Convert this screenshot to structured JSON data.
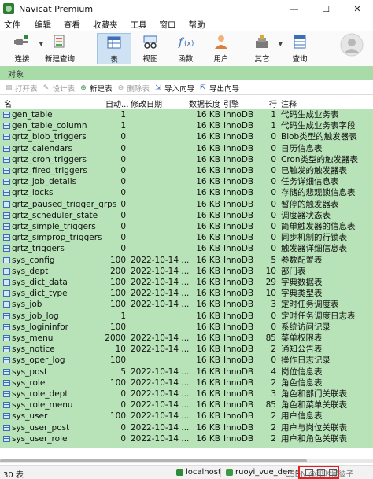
{
  "window": {
    "title": "Navicat Premium",
    "minimize": "—",
    "maximize": "☐",
    "close": "✕"
  },
  "menu": [
    "文件",
    "编辑",
    "查看",
    "收藏夹",
    "工具",
    "窗口",
    "帮助"
  ],
  "toolbar": {
    "connect": "连接",
    "new_query": "新建查询",
    "table": "表",
    "view": "视图",
    "function": "函数",
    "user": "用户",
    "other": "其它",
    "query": "查询"
  },
  "tabs": {
    "objects": "对象"
  },
  "object_toolbar": {
    "open": "打开表",
    "design": "设计表",
    "new": "新建表",
    "delete": "删除表",
    "import": "导入向导",
    "export": "导出向导"
  },
  "columns": {
    "name": "名",
    "auto_inc": "自动...",
    "modified": "修改日期",
    "data_length": "数据长度",
    "engine": "引擎",
    "rows": "行",
    "comment": "注释"
  },
  "rows": [
    {
      "name": "gen_table",
      "auto": "1",
      "mod": "",
      "len": "16 KB",
      "eng": "InnoDB",
      "rows": "1",
      "cmt": "代码生成业务表"
    },
    {
      "name": "gen_table_column",
      "auto": "1",
      "mod": "",
      "len": "16 KB",
      "eng": "InnoDB",
      "rows": "1",
      "cmt": "代码生成业务表字段"
    },
    {
      "name": "qrtz_blob_triggers",
      "auto": "0",
      "mod": "",
      "len": "16 KB",
      "eng": "InnoDB",
      "rows": "0",
      "cmt": "Blob类型的触发器表"
    },
    {
      "name": "qrtz_calendars",
      "auto": "0",
      "mod": "",
      "len": "16 KB",
      "eng": "InnoDB",
      "rows": "0",
      "cmt": "日历信息表"
    },
    {
      "name": "qrtz_cron_triggers",
      "auto": "0",
      "mod": "",
      "len": "16 KB",
      "eng": "InnoDB",
      "rows": "0",
      "cmt": "Cron类型的触发器表"
    },
    {
      "name": "qrtz_fired_triggers",
      "auto": "0",
      "mod": "",
      "len": "16 KB",
      "eng": "InnoDB",
      "rows": "0",
      "cmt": "已触发的触发器表"
    },
    {
      "name": "qrtz_job_details",
      "auto": "0",
      "mod": "",
      "len": "16 KB",
      "eng": "InnoDB",
      "rows": "0",
      "cmt": "任务详细信息表"
    },
    {
      "name": "qrtz_locks",
      "auto": "0",
      "mod": "",
      "len": "16 KB",
      "eng": "InnoDB",
      "rows": "0",
      "cmt": "存储的悲观锁信息表"
    },
    {
      "name": "qrtz_paused_trigger_grps",
      "auto": "0",
      "mod": "",
      "len": "16 KB",
      "eng": "InnoDB",
      "rows": "0",
      "cmt": "暂停的触发器表"
    },
    {
      "name": "qrtz_scheduler_state",
      "auto": "0",
      "mod": "",
      "len": "16 KB",
      "eng": "InnoDB",
      "rows": "0",
      "cmt": "调度器状态表"
    },
    {
      "name": "qrtz_simple_triggers",
      "auto": "0",
      "mod": "",
      "len": "16 KB",
      "eng": "InnoDB",
      "rows": "0",
      "cmt": "简单触发器的信息表"
    },
    {
      "name": "qrtz_simprop_triggers",
      "auto": "0",
      "mod": "",
      "len": "16 KB",
      "eng": "InnoDB",
      "rows": "0",
      "cmt": "同步机制的行锁表"
    },
    {
      "name": "qrtz_triggers",
      "auto": "0",
      "mod": "",
      "len": "16 KB",
      "eng": "InnoDB",
      "rows": "0",
      "cmt": "触发器详细信息表"
    },
    {
      "name": "sys_config",
      "auto": "100",
      "mod": "2022-10-14 ...",
      "len": "16 KB",
      "eng": "InnoDB",
      "rows": "5",
      "cmt": "参数配置表"
    },
    {
      "name": "sys_dept",
      "auto": "200",
      "mod": "2022-10-14 ...",
      "len": "16 KB",
      "eng": "InnoDB",
      "rows": "10",
      "cmt": "部门表"
    },
    {
      "name": "sys_dict_data",
      "auto": "100",
      "mod": "2022-10-14 ...",
      "len": "16 KB",
      "eng": "InnoDB",
      "rows": "29",
      "cmt": "字典数据表"
    },
    {
      "name": "sys_dict_type",
      "auto": "100",
      "mod": "2022-10-14 ...",
      "len": "16 KB",
      "eng": "InnoDB",
      "rows": "10",
      "cmt": "字典类型表"
    },
    {
      "name": "sys_job",
      "auto": "100",
      "mod": "2022-10-14 ...",
      "len": "16 KB",
      "eng": "InnoDB",
      "rows": "3",
      "cmt": "定时任务调度表"
    },
    {
      "name": "sys_job_log",
      "auto": "1",
      "mod": "",
      "len": "16 KB",
      "eng": "InnoDB",
      "rows": "0",
      "cmt": "定时任务调度日志表"
    },
    {
      "name": "sys_logininfor",
      "auto": "100",
      "mod": "",
      "len": "16 KB",
      "eng": "InnoDB",
      "rows": "0",
      "cmt": "系统访问记录"
    },
    {
      "name": "sys_menu",
      "auto": "2000",
      "mod": "2022-10-14 ...",
      "len": "16 KB",
      "eng": "InnoDB",
      "rows": "85",
      "cmt": "菜单权限表"
    },
    {
      "name": "sys_notice",
      "auto": "10",
      "mod": "2022-10-14 ...",
      "len": "16 KB",
      "eng": "InnoDB",
      "rows": "2",
      "cmt": "通知公告表"
    },
    {
      "name": "sys_oper_log",
      "auto": "100",
      "mod": "",
      "len": "16 KB",
      "eng": "InnoDB",
      "rows": "0",
      "cmt": "操作日志记录"
    },
    {
      "name": "sys_post",
      "auto": "5",
      "mod": "2022-10-14 ...",
      "len": "16 KB",
      "eng": "InnoDB",
      "rows": "4",
      "cmt": "岗位信息表"
    },
    {
      "name": "sys_role",
      "auto": "100",
      "mod": "2022-10-14 ...",
      "len": "16 KB",
      "eng": "InnoDB",
      "rows": "2",
      "cmt": "角色信息表"
    },
    {
      "name": "sys_role_dept",
      "auto": "0",
      "mod": "2022-10-14 ...",
      "len": "16 KB",
      "eng": "InnoDB",
      "rows": "3",
      "cmt": "角色和部门关联表"
    },
    {
      "name": "sys_role_menu",
      "auto": "0",
      "mod": "2022-10-14 ...",
      "len": "16 KB",
      "eng": "InnoDB",
      "rows": "85",
      "cmt": "角色和菜单关联表"
    },
    {
      "name": "sys_user",
      "auto": "100",
      "mod": "2022-10-14 ...",
      "len": "16 KB",
      "eng": "InnoDB",
      "rows": "2",
      "cmt": "用户信息表"
    },
    {
      "name": "sys_user_post",
      "auto": "0",
      "mod": "2022-10-14 ...",
      "len": "16 KB",
      "eng": "InnoDB",
      "rows": "2",
      "cmt": "用户与岗位关联表"
    },
    {
      "name": "sys_user_role",
      "auto": "0",
      "mod": "2022-10-14 ...",
      "len": "16 KB",
      "eng": "InnoDB",
      "rows": "2",
      "cmt": "用户和角色关联表"
    }
  ],
  "status": {
    "count": "30 表",
    "connection": "localhost",
    "database": "ruoyi_vue_demo",
    "watermark": "CSDN @那时候彼子"
  },
  "colors": {
    "grid_bg": "#b8e3b8",
    "tab_bg": "#a8dba8",
    "highlight_box": "#e02020"
  }
}
